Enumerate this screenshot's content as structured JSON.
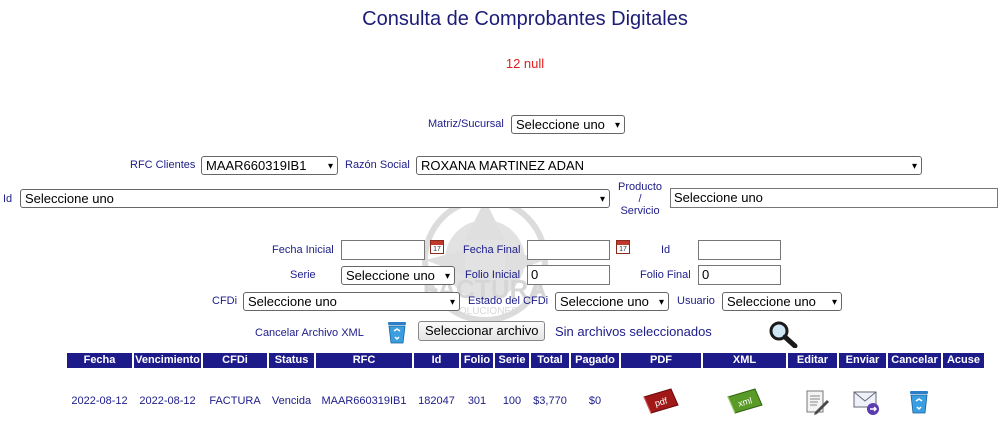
{
  "page": {
    "title": "Consulta de Comprobantes Digitales",
    "message": "12 null"
  },
  "filters": {
    "matriz_label": "Matriz/Sucursal",
    "matriz_value": "Seleccione uno",
    "rfc_label": "RFC Clientes",
    "rfc_value": "MAAR660319IB1",
    "razon_label": "Razón Social",
    "razon_value": "ROXANA MARTINEZ ADAN",
    "id_label": "Id",
    "id_value": "Seleccione uno",
    "producto_label_1": "Producto",
    "producto_label_2": "/",
    "producto_label_3": "Servicio",
    "producto_value": "Seleccione uno",
    "fecha_inicial_label": "Fecha Inicial",
    "fecha_final_label": "Fecha Final",
    "id2_label": "Id",
    "calendar_day": "17",
    "serie_label": "Serie",
    "serie_value": "Seleccione uno",
    "folio_inicial_label": "Folio Inicial",
    "folio_inicial_value": "0",
    "folio_final_label": "Folio Final",
    "folio_final_value": "0",
    "cfdi_label": "CFDi",
    "cfdi_value": "Seleccione uno",
    "estado_label": "Estado del CFDi",
    "estado_value": "Seleccione uno",
    "usuario_label": "Usuario",
    "usuario_value": "Seleccione uno",
    "cancelar_xml_label": "Cancelar Archivo XML",
    "file_button": "Seleccionar archivo",
    "file_status": "Sin archivos seleccionados"
  },
  "watermark": {
    "text_1": "FACTURA",
    "text_2": "SOLUCIONES"
  },
  "table": {
    "headers": [
      "Fecha",
      "Vencimiento",
      "CFDi",
      "Status",
      "RFC",
      "Id",
      "Folio",
      "Serie",
      "Total",
      "Pagado",
      "PDF",
      "XML",
      "Editar",
      "Enviar",
      "Cancelar",
      "Acuse"
    ],
    "rows": [
      {
        "fecha": "2022-08-12",
        "vencimiento": "2022-08-12",
        "cfdi": "FACTURA",
        "status": "Vencida",
        "rfc": "MAAR660319IB1",
        "id": "182047",
        "folio": "301",
        "serie": "100",
        "total": "$3,770",
        "pagado": "$0",
        "pdf_icon": "pdf-file-icon",
        "pdf_text": "pdf",
        "xml_icon": "xml-file-icon",
        "xml_text": "xml",
        "edit_icon": "edit-document-icon",
        "send_icon": "envelope-send-icon",
        "cancel_icon": "recycle-bin-icon"
      }
    ]
  },
  "colors": {
    "header_bg": "#1d1a8a",
    "title": "#1c1c78",
    "message": "#e02020",
    "label": "#1c1c8a"
  }
}
